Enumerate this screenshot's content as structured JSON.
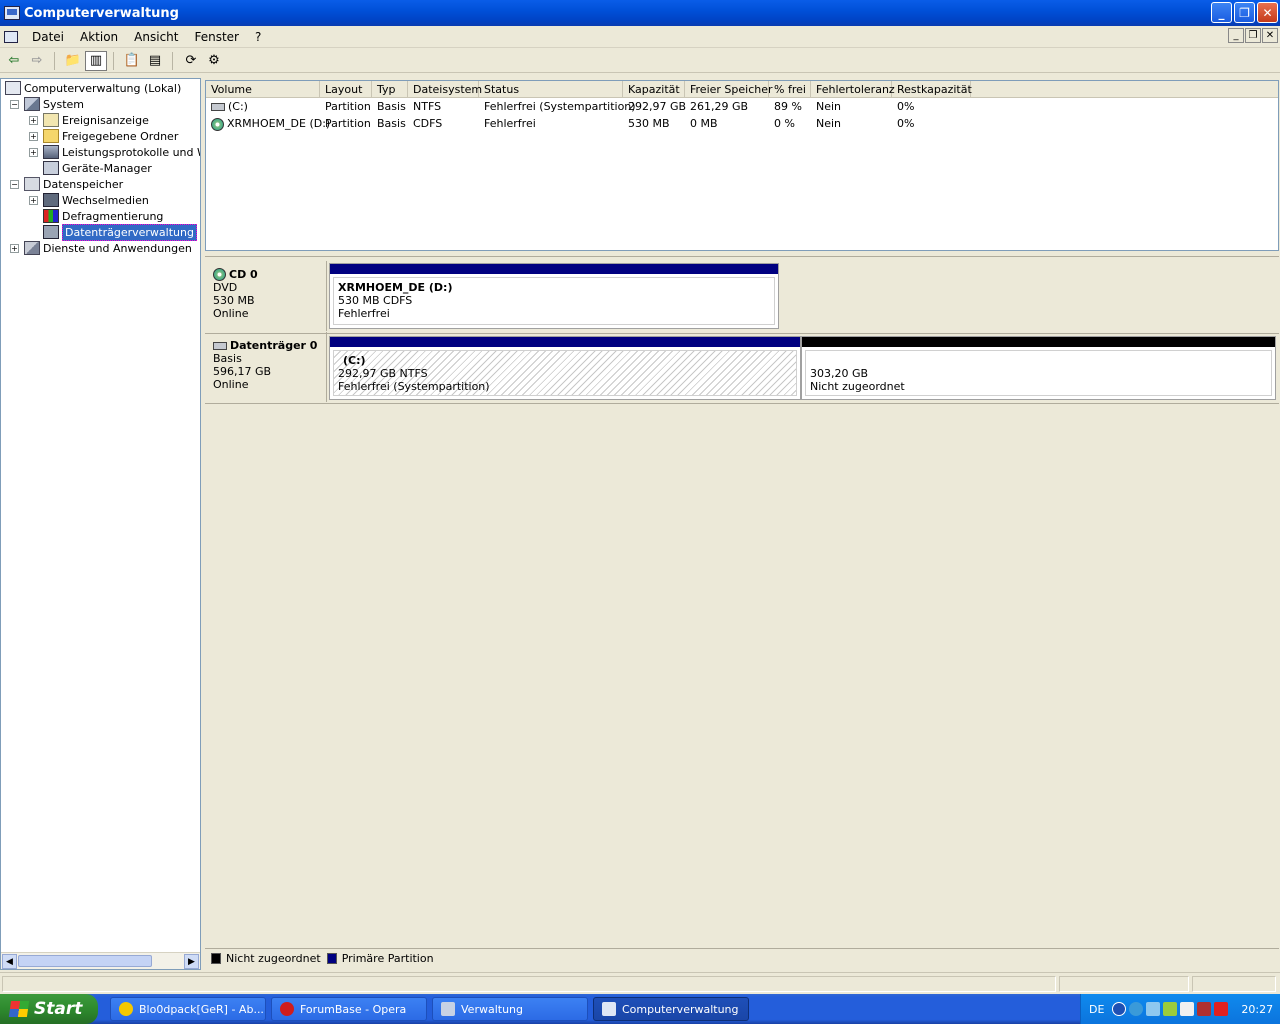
{
  "window": {
    "title": "Computerverwaltung"
  },
  "menu": [
    "Datei",
    "Aktion",
    "Ansicht",
    "Fenster",
    "?"
  ],
  "tree": {
    "root": "Computerverwaltung (Lokal)",
    "system": "System",
    "ereignisanzeige": "Ereignisanzeige",
    "freigegebene_ordner": "Freigegebene Ordner",
    "leistungsprotokolle": "Leistungsprotokolle und War",
    "geraete_manager": "Geräte-Manager",
    "datenspeicher": "Datenspeicher",
    "wechselmedien": "Wechselmedien",
    "defragmentierung": "Defragmentierung",
    "datentraegerverwaltung": "Datenträgerverwaltung",
    "dienste": "Dienste und Anwendungen"
  },
  "volumes": {
    "headers": [
      "Volume",
      "Layout",
      "Typ",
      "Dateisystem",
      "Status",
      "Kapazität",
      "Freier Speicher",
      "% frei",
      "Fehlertoleranz",
      "Restkapazität"
    ],
    "rows": [
      [
        "(C:)",
        "Partition",
        "Basis",
        "NTFS",
        "Fehlerfrei (Systempartition)",
        "292,97 GB",
        "261,29 GB",
        "89 %",
        "Nein",
        "0%"
      ],
      [
        "XRMHOEM_DE (D:)",
        "Partition",
        "Basis",
        "CDFS",
        "Fehlerfrei",
        "530 MB",
        "0 MB",
        "0 %",
        "Nein",
        "0%"
      ]
    ]
  },
  "disks": {
    "cd0": {
      "name": "CD 0",
      "type": "DVD",
      "size": "530 MB",
      "state": "Online",
      "partition": {
        "name": "XRMHOEM_DE  (D:)",
        "detail": "530 MB CDFS",
        "status": "Fehlerfrei"
      }
    },
    "disk0": {
      "name": "Datenträger 0",
      "type": "Basis",
      "size": "596,17 GB",
      "state": "Online",
      "partition_c": {
        "name": "(C:)",
        "detail": "292,97 GB NTFS",
        "status": "Fehlerfrei (Systempartition)"
      },
      "unallocated": {
        "size": "303,20 GB",
        "status": "Nicht zugeordnet"
      }
    }
  },
  "legend": {
    "unallocated": "Nicht zugeordnet",
    "primary": "Primäre Partition"
  },
  "colors": {
    "primary": "#000080",
    "unallocated": "#000000",
    "selection": "#316AC5"
  },
  "taskbar": {
    "start": "Start",
    "tasks": [
      "Blo0dpack[GeR] - Ab...",
      "ForumBase - Opera",
      "Verwaltung",
      "Computerverwaltung"
    ],
    "lang": "DE",
    "clock": "20:27"
  }
}
